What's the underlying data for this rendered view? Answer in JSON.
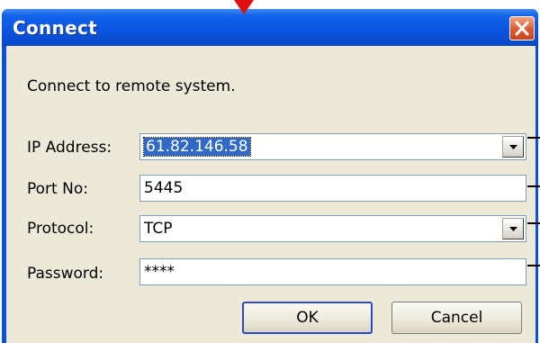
{
  "window": {
    "title": "Connect"
  },
  "dialog": {
    "heading": "Connect to remote system.",
    "ip": {
      "label": "IP Address:",
      "value": "61.82.146.58"
    },
    "port": {
      "label": "Port No:",
      "value": "5445"
    },
    "protocol": {
      "label": "Protocol:",
      "value": "TCP"
    },
    "password": {
      "label": "Password:",
      "value": "****"
    }
  },
  "buttons": {
    "ok": "OK",
    "cancel": "Cancel"
  },
  "icons": {
    "close": "close-icon",
    "dropdown": "chevron-down-icon",
    "annotation": "red-down-arrow-icon"
  },
  "colors": {
    "titlebar": "#0b55e3",
    "client": "#ece9d8",
    "close": "#dd5a2f",
    "selection": "#316ac5",
    "annotation": "#e01010"
  }
}
